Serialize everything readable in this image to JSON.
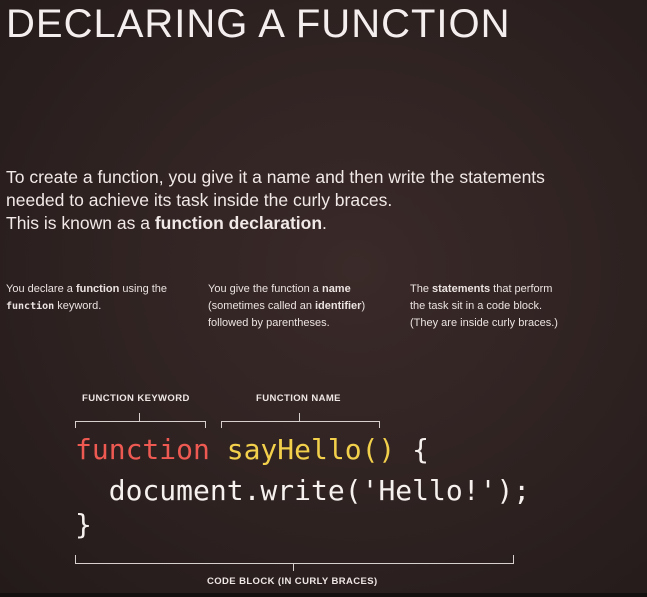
{
  "title": "DECLARING A FUNCTION",
  "intro": {
    "line1": "To create a function, you give it a name and then write the statements",
    "line2": "needed to achieve its task inside the curly braces.",
    "line3_prefix": "This is known as a ",
    "line3_bold": "function declaration",
    "line3_suffix": "."
  },
  "notes": {
    "keyword": {
      "a": "You declare a ",
      "b": "function",
      "c": " using the",
      "d": "function",
      "e": " keyword."
    },
    "name": {
      "a": "You give the function a ",
      "b": "name",
      "c": "(sometimes called an ",
      "d": "identifier",
      "e": ")",
      "f": "followed by parentheses."
    },
    "statements": {
      "a": "The ",
      "b": "statements",
      "c": " that perform",
      "d": "the task sit in a code block.",
      "e": "(They are inside curly braces.)"
    }
  },
  "labels": {
    "keyword": "FUNCTION KEYWORD",
    "name": "FUNCTION NAME",
    "block": "CODE BLOCK (IN CURLY BRACES)"
  },
  "code": {
    "keyword": "function",
    "name": "sayHello()",
    "open_brace": "{",
    "statement": "document.write('Hello!');",
    "close_brace": "}"
  },
  "colors": {
    "keyword": "#ee5a52",
    "name": "#f2d04b",
    "background": "#2e2221"
  }
}
